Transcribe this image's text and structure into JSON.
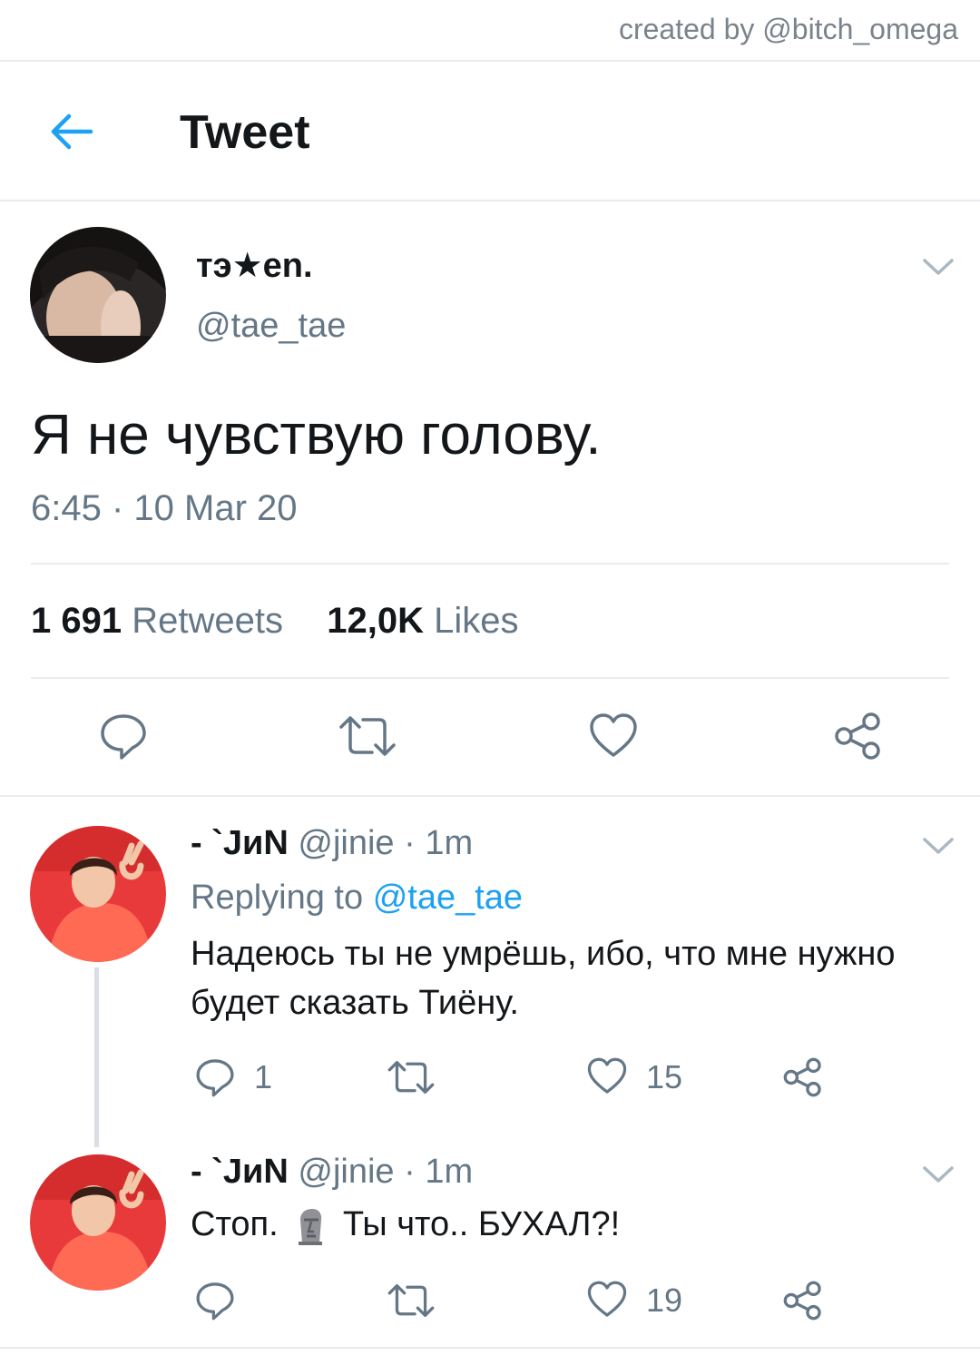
{
  "watermark": "created by @bitch_omega",
  "header": {
    "title": "Tweet",
    "back_icon": "arrow-left-icon"
  },
  "tweet": {
    "display_name": "тэ★еn.",
    "handle": "@tae_tae",
    "text": "Я не чувствую голову.",
    "timestamp": "6:45 · 10 Mar 20",
    "retweets_count": "1 691",
    "retweets_label": "Retweets",
    "likes_count": "12,0K",
    "likes_label": "Likes",
    "actions": [
      "comment-icon",
      "retweet-icon",
      "heart-icon",
      "share-icon"
    ]
  },
  "replies": [
    {
      "display_name": "- `JиN",
      "meta": "@jinie · 1m",
      "replying_prefix": "Replying to",
      "replying_handle": "@tae_tae",
      "text": "Надеюсь ты не умрёшь, ибо, что мне нужно будет сказать Тиёну.",
      "reply_count": "1",
      "retweet_count": "",
      "like_count": "15"
    },
    {
      "display_name": "- `JиN",
      "meta": "@jinie · 1m",
      "text_before": "Стоп.",
      "emoji": "moai-emoji",
      "text_after": "Ты что.. БУХАЛ?!",
      "reply_count": "",
      "retweet_count": "",
      "like_count": "19"
    }
  ],
  "colors": {
    "accent": "#1da1f2",
    "muted": "#657786",
    "divider": "#e6ecf0",
    "jin_bg": "#e83a3a"
  }
}
